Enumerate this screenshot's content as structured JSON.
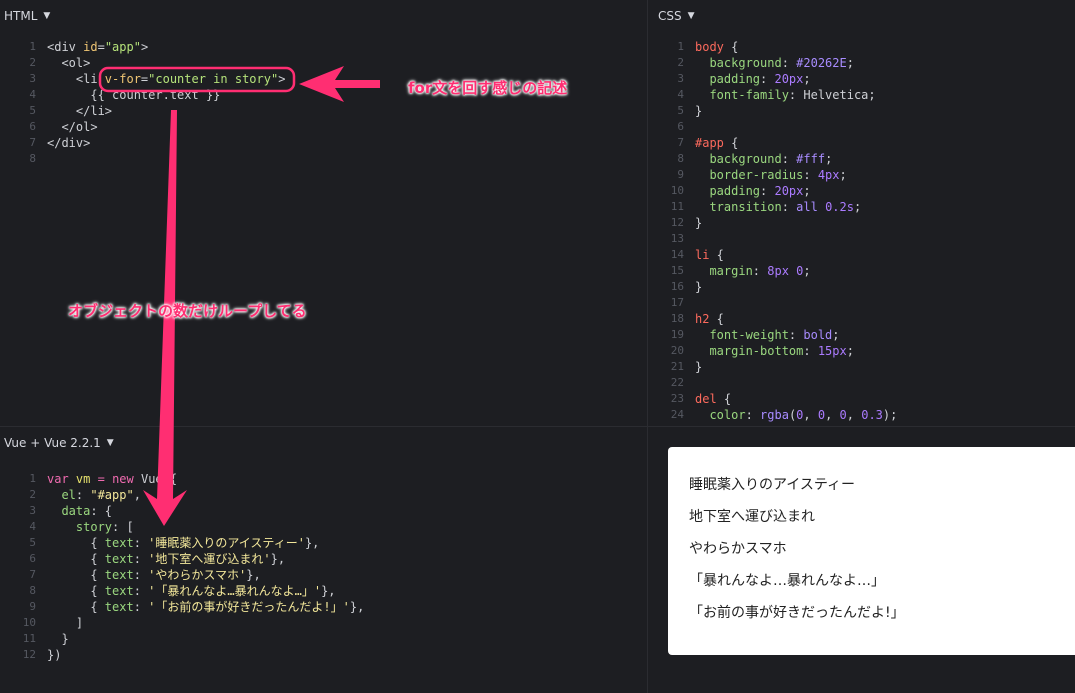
{
  "panes": {
    "html": {
      "title": "HTML",
      "icon": "chevron-down-icon"
    },
    "css": {
      "title": "CSS",
      "icon": "chevron-down-icon"
    },
    "js": {
      "title": "Vue + Vue 2.2.1",
      "icon": "chevron-down-icon"
    }
  },
  "chevron": "▼",
  "html_lines": [
    {
      "n": "1",
      "tokens": [
        [
          "t-tag",
          "<div "
        ],
        [
          "t-attr",
          "id"
        ],
        [
          "t-tag",
          "="
        ],
        [
          "t-str",
          "\"app\""
        ],
        [
          "t-tag",
          ">"
        ]
      ]
    },
    {
      "n": "2",
      "tokens": [
        [
          "t-tag",
          "  <ol>"
        ]
      ]
    },
    {
      "n": "3",
      "tokens": [
        [
          "t-tag",
          "    <li "
        ],
        [
          "t-attr",
          "v-for"
        ],
        [
          "t-tag",
          "="
        ],
        [
          "t-str",
          "\"counter in story\""
        ],
        [
          "t-tag",
          ">"
        ]
      ]
    },
    {
      "n": "4",
      "tokens": [
        [
          "t-tag",
          "      {{ counter.text }}"
        ]
      ]
    },
    {
      "n": "5",
      "tokens": [
        [
          "t-tag",
          "    </li>"
        ]
      ]
    },
    {
      "n": "6",
      "tokens": [
        [
          "t-tag",
          "  </ol>"
        ]
      ]
    },
    {
      "n": "7",
      "tokens": [
        [
          "t-tag",
          "</div>"
        ]
      ]
    },
    {
      "n": "8",
      "tokens": [
        [
          "t-tag",
          ""
        ]
      ]
    }
  ],
  "css_lines": [
    {
      "n": "1",
      "tokens": [
        [
          "t-sel",
          "body"
        ],
        [
          "t-tag",
          " {"
        ]
      ]
    },
    {
      "n": "2",
      "tokens": [
        [
          "t-prop",
          "  background"
        ],
        [
          "t-tag",
          ": "
        ],
        [
          "t-hex",
          "#20262E"
        ],
        [
          "t-tag",
          ";"
        ]
      ]
    },
    {
      "n": "3",
      "tokens": [
        [
          "t-prop",
          "  padding"
        ],
        [
          "t-tag",
          ": "
        ],
        [
          "t-num",
          "20px"
        ],
        [
          "t-tag",
          ";"
        ]
      ]
    },
    {
      "n": "4",
      "tokens": [
        [
          "t-prop",
          "  font-family"
        ],
        [
          "t-tag",
          ": Helvetica;"
        ]
      ]
    },
    {
      "n": "5",
      "tokens": [
        [
          "t-tag",
          "}"
        ]
      ]
    },
    {
      "n": "6",
      "tokens": [
        [
          "t-tag",
          ""
        ]
      ]
    },
    {
      "n": "7",
      "tokens": [
        [
          "t-sel",
          "#app"
        ],
        [
          "t-tag",
          " {"
        ]
      ]
    },
    {
      "n": "8",
      "tokens": [
        [
          "t-prop",
          "  background"
        ],
        [
          "t-tag",
          ": "
        ],
        [
          "t-hex",
          "#fff"
        ],
        [
          "t-tag",
          ";"
        ]
      ]
    },
    {
      "n": "9",
      "tokens": [
        [
          "t-prop",
          "  border-radius"
        ],
        [
          "t-tag",
          ": "
        ],
        [
          "t-num",
          "4px"
        ],
        [
          "t-tag",
          ";"
        ]
      ]
    },
    {
      "n": "10",
      "tokens": [
        [
          "t-prop",
          "  padding"
        ],
        [
          "t-tag",
          ": "
        ],
        [
          "t-num",
          "20px"
        ],
        [
          "t-tag",
          ";"
        ]
      ]
    },
    {
      "n": "11",
      "tokens": [
        [
          "t-prop",
          "  transition"
        ],
        [
          "t-tag",
          ": "
        ],
        [
          "t-hex",
          "all"
        ],
        [
          "t-tag",
          " "
        ],
        [
          "t-num",
          "0.2s"
        ],
        [
          "t-tag",
          ";"
        ]
      ]
    },
    {
      "n": "12",
      "tokens": [
        [
          "t-tag",
          "}"
        ]
      ]
    },
    {
      "n": "13",
      "tokens": [
        [
          "t-tag",
          ""
        ]
      ]
    },
    {
      "n": "14",
      "tokens": [
        [
          "t-sel",
          "li"
        ],
        [
          "t-tag",
          " {"
        ]
      ]
    },
    {
      "n": "15",
      "tokens": [
        [
          "t-prop",
          "  margin"
        ],
        [
          "t-tag",
          ": "
        ],
        [
          "t-num",
          "8px 0"
        ],
        [
          "t-tag",
          ";"
        ]
      ]
    },
    {
      "n": "16",
      "tokens": [
        [
          "t-tag",
          "}"
        ]
      ]
    },
    {
      "n": "17",
      "tokens": [
        [
          "t-tag",
          ""
        ]
      ]
    },
    {
      "n": "18",
      "tokens": [
        [
          "t-sel",
          "h2"
        ],
        [
          "t-tag",
          " {"
        ]
      ]
    },
    {
      "n": "19",
      "tokens": [
        [
          "t-prop",
          "  font-weight"
        ],
        [
          "t-tag",
          ": "
        ],
        [
          "t-hex",
          "bold"
        ],
        [
          "t-tag",
          ";"
        ]
      ]
    },
    {
      "n": "20",
      "tokens": [
        [
          "t-prop",
          "  margin-bottom"
        ],
        [
          "t-tag",
          ": "
        ],
        [
          "t-num",
          "15px"
        ],
        [
          "t-tag",
          ";"
        ]
      ]
    },
    {
      "n": "21",
      "tokens": [
        [
          "t-tag",
          "}"
        ]
      ]
    },
    {
      "n": "22",
      "tokens": [
        [
          "t-tag",
          ""
        ]
      ]
    },
    {
      "n": "23",
      "tokens": [
        [
          "t-sel",
          "del"
        ],
        [
          "t-tag",
          " {"
        ]
      ]
    },
    {
      "n": "24",
      "tokens": [
        [
          "t-prop",
          "  color"
        ],
        [
          "t-tag",
          ": "
        ],
        [
          "t-hex",
          "rgba"
        ],
        [
          "t-tag",
          "("
        ],
        [
          "t-num",
          "0"
        ],
        [
          "t-tag",
          ", "
        ],
        [
          "t-num",
          "0"
        ],
        [
          "t-tag",
          ", "
        ],
        [
          "t-num",
          "0"
        ],
        [
          "t-tag",
          ", "
        ],
        [
          "t-num",
          "0.3"
        ],
        [
          "t-tag",
          ");"
        ]
      ]
    }
  ],
  "js_lines": [
    {
      "n": "1",
      "tokens": [
        [
          "t-kw",
          "var "
        ],
        [
          "t-var",
          "vm"
        ],
        [
          "t-tag",
          " "
        ],
        [
          "t-kw",
          "="
        ],
        [
          "t-tag",
          " "
        ],
        [
          "t-kw",
          "new"
        ],
        [
          "t-tag",
          " Vue({"
        ]
      ]
    },
    {
      "n": "2",
      "tokens": [
        [
          "t-tag",
          "  "
        ],
        [
          "t-key",
          "el"
        ],
        [
          "t-tag",
          ": "
        ],
        [
          "t-jstr",
          "\"#app\""
        ],
        [
          "t-tag",
          ","
        ]
      ]
    },
    {
      "n": "3",
      "tokens": [
        [
          "t-tag",
          "  "
        ],
        [
          "t-key",
          "data"
        ],
        [
          "t-tag",
          ": {"
        ]
      ]
    },
    {
      "n": "4",
      "tokens": [
        [
          "t-tag",
          "    "
        ],
        [
          "t-key",
          "story"
        ],
        [
          "t-tag",
          ": ["
        ]
      ]
    },
    {
      "n": "5",
      "tokens": [
        [
          "t-tag",
          "      { "
        ],
        [
          "t-key",
          "text"
        ],
        [
          "t-tag",
          ": "
        ],
        [
          "t-jstr",
          "'睡眠薬入りのアイスティー'"
        ],
        [
          "t-tag",
          "},"
        ]
      ]
    },
    {
      "n": "6",
      "tokens": [
        [
          "t-tag",
          "      { "
        ],
        [
          "t-key",
          "text"
        ],
        [
          "t-tag",
          ": "
        ],
        [
          "t-jstr",
          "'地下室へ運び込まれ'"
        ],
        [
          "t-tag",
          "},"
        ]
      ]
    },
    {
      "n": "7",
      "tokens": [
        [
          "t-tag",
          "      { "
        ],
        [
          "t-key",
          "text"
        ],
        [
          "t-tag",
          ": "
        ],
        [
          "t-jstr",
          "'やわらかスマホ'"
        ],
        [
          "t-tag",
          "},"
        ]
      ]
    },
    {
      "n": "8",
      "tokens": [
        [
          "t-tag",
          "      { "
        ],
        [
          "t-key",
          "text"
        ],
        [
          "t-tag",
          ": "
        ],
        [
          "t-jstr",
          "'「暴れんなよ…暴れんなよ…」'"
        ],
        [
          "t-tag",
          "},"
        ]
      ]
    },
    {
      "n": "9",
      "tokens": [
        [
          "t-tag",
          "      { "
        ],
        [
          "t-key",
          "text"
        ],
        [
          "t-tag",
          ": "
        ],
        [
          "t-jstr",
          "'「お前の事が好きだったんだよ!」'"
        ],
        [
          "t-tag",
          "},"
        ]
      ]
    },
    {
      "n": "10",
      "tokens": [
        [
          "t-tag",
          "    ]"
        ]
      ]
    },
    {
      "n": "11",
      "tokens": [
        [
          "t-tag",
          "  }"
        ]
      ]
    },
    {
      "n": "12",
      "tokens": [
        [
          "t-tag",
          "})"
        ]
      ]
    }
  ],
  "result": {
    "items": [
      "睡眠薬入りのアイスティー",
      "地下室へ運び込まれ",
      "やわらかスマホ",
      "「暴れんなよ…暴れんなよ…」",
      "「お前の事が好きだったんだよ!」"
    ]
  },
  "annotations": {
    "for_note": "for文を回す感じの記述",
    "loop_note": "オブジェクトの数だけループしてる",
    "color": "#ff2e72"
  }
}
